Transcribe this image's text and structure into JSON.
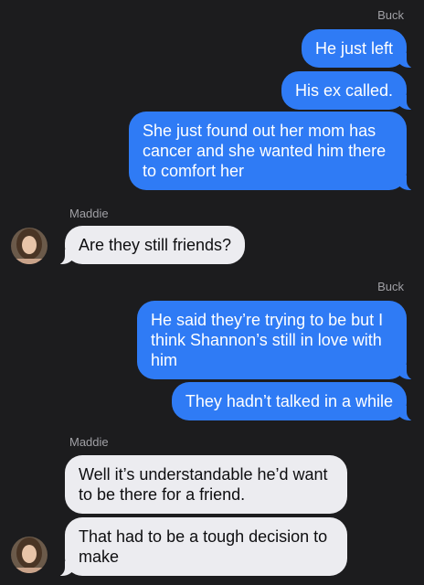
{
  "thread": {
    "messages": [
      {
        "sender": "Buck",
        "direction": "out",
        "text": "He just left"
      },
      {
        "sender": "Buck",
        "direction": "out",
        "text": "His ex called."
      },
      {
        "sender": "Buck",
        "direction": "out",
        "text": "She just found out her mom has cancer and she wanted him there to comfort her"
      },
      {
        "sender": "Maddie",
        "direction": "in",
        "text": "Are they still friends?"
      },
      {
        "sender": "Buck",
        "direction": "out",
        "text": "He said they’re trying to be but I think Shannon’s still in love with him"
      },
      {
        "sender": "Buck",
        "direction": "out",
        "text": "They hadn’t talked in a while"
      },
      {
        "sender": "Maddie",
        "direction": "in",
        "text": "Well it’s understandable he’d want to be there for a friend."
      },
      {
        "sender": "Maddie",
        "direction": "in",
        "text": "That had to be a tough decision to make"
      }
    ],
    "sender_labels": {
      "buck_1": "Buck",
      "maddie_1": "Maddie",
      "buck_2": "Buck",
      "maddie_2": "Maddie"
    }
  },
  "colors": {
    "background": "#1c1c1e",
    "outgoing_bubble": "#2f7bf5",
    "incoming_bubble": "#ececf0",
    "sender_label": "#a0a0a5"
  },
  "icons": {
    "avatar": "maddie-avatar-photo"
  }
}
